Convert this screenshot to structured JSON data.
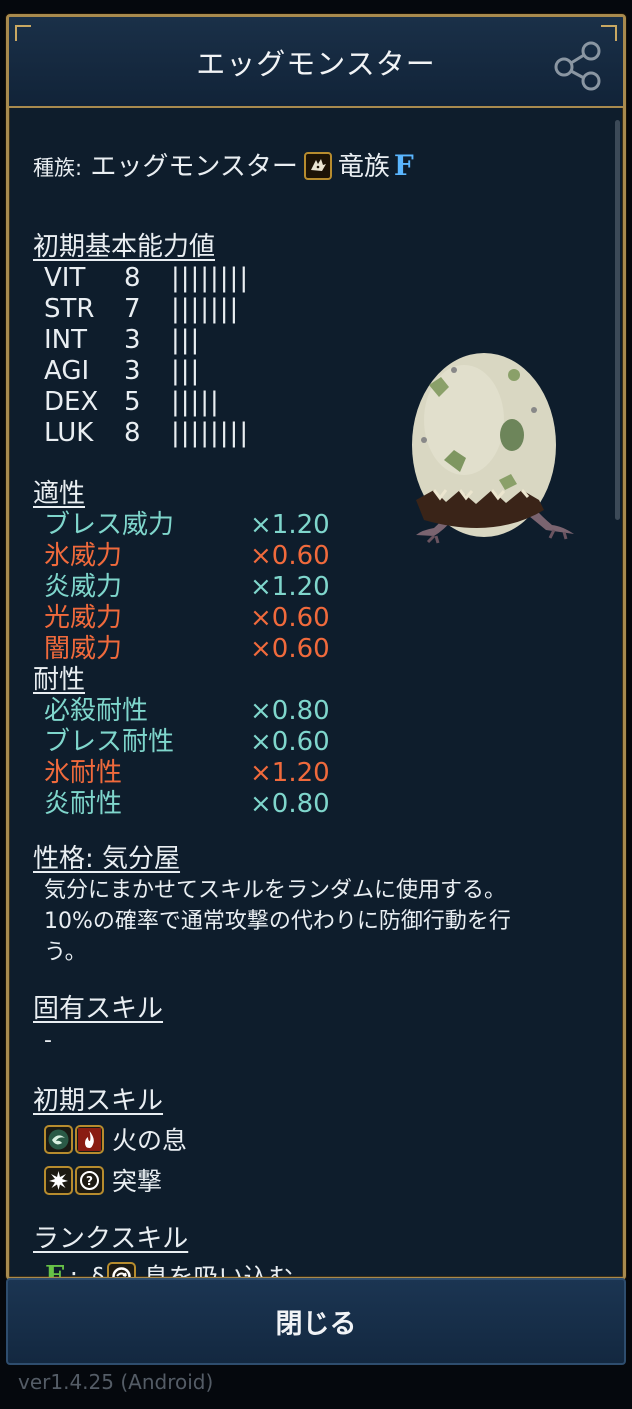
{
  "dialog": {
    "title": "エッグモンスター"
  },
  "tribe": {
    "label": "種族:",
    "name": "エッグモンスター",
    "family": "竜族",
    "rank": "F"
  },
  "base_stats": {
    "heading": "初期基本能力値",
    "rows": [
      {
        "name": "VIT",
        "value": "8",
        "bars": "||||||||"
      },
      {
        "name": "STR",
        "value": "7",
        "bars": "|||||||"
      },
      {
        "name": "INT",
        "value": "3",
        "bars": "|||"
      },
      {
        "name": "AGI",
        "value": "3",
        "bars": "|||"
      },
      {
        "name": "DEX",
        "value": "5",
        "bars": "|||||"
      },
      {
        "name": "LUK",
        "value": "8",
        "bars": "||||||||"
      }
    ]
  },
  "aptitude": {
    "heading": "適性",
    "rows": [
      {
        "name": "ブレス威力",
        "mult": "×1.20",
        "color": "#7fd6cc"
      },
      {
        "name": "氷威力",
        "mult": "×0.60",
        "color": "#f06a3c"
      },
      {
        "name": "炎威力",
        "mult": "×1.20",
        "color": "#7fd6cc"
      },
      {
        "name": "光威力",
        "mult": "×0.60",
        "color": "#f06a3c"
      },
      {
        "name": "闇威力",
        "mult": "×0.60",
        "color": "#f06a3c"
      }
    ]
  },
  "resistance": {
    "heading": "耐性",
    "rows": [
      {
        "name": "必殺耐性",
        "mult": "×0.80",
        "color": "#7fd6cc"
      },
      {
        "name": "ブレス耐性",
        "mult": "×0.60",
        "color": "#7fd6cc"
      },
      {
        "name": "氷耐性",
        "mult": "×1.20",
        "color": "#f06a3c"
      },
      {
        "name": "炎耐性",
        "mult": "×0.80",
        "color": "#7fd6cc"
      }
    ]
  },
  "personality": {
    "heading": "性格: 気分屋",
    "line1": "気分にまかせてスキルをランダムに使用する。",
    "line2": "10%の確率で通常攻撃の代わりに防御行動を行",
    "line3": "う。"
  },
  "unique_skill": {
    "heading": "固有スキル",
    "value": "-"
  },
  "initial_skills": {
    "heading": "初期スキル",
    "items": [
      {
        "name": "火の息",
        "icons": [
          "breath-icon",
          "fire-icon"
        ]
      },
      {
        "name": "突撃",
        "icons": [
          "burst-icon",
          "question-icon"
        ]
      }
    ]
  },
  "rank_skills": {
    "heading": "ランクスキル",
    "items": [
      {
        "rank": "E",
        "sep": ":",
        "mark": "§",
        "name": "息を吸い込む",
        "icons": [
          "inhale-icon"
        ]
      }
    ]
  },
  "close_button": {
    "label": "閉じる"
  },
  "footer": {
    "version": "ver1.4.25 (Android)"
  },
  "colors": {
    "frame_gold": "#a88a4e",
    "panel": "#0e1d2c",
    "good": "#7fd6cc",
    "bad": "#f06a3c",
    "rank_f": "#5ab6ff",
    "rank_e": "#67c247"
  }
}
